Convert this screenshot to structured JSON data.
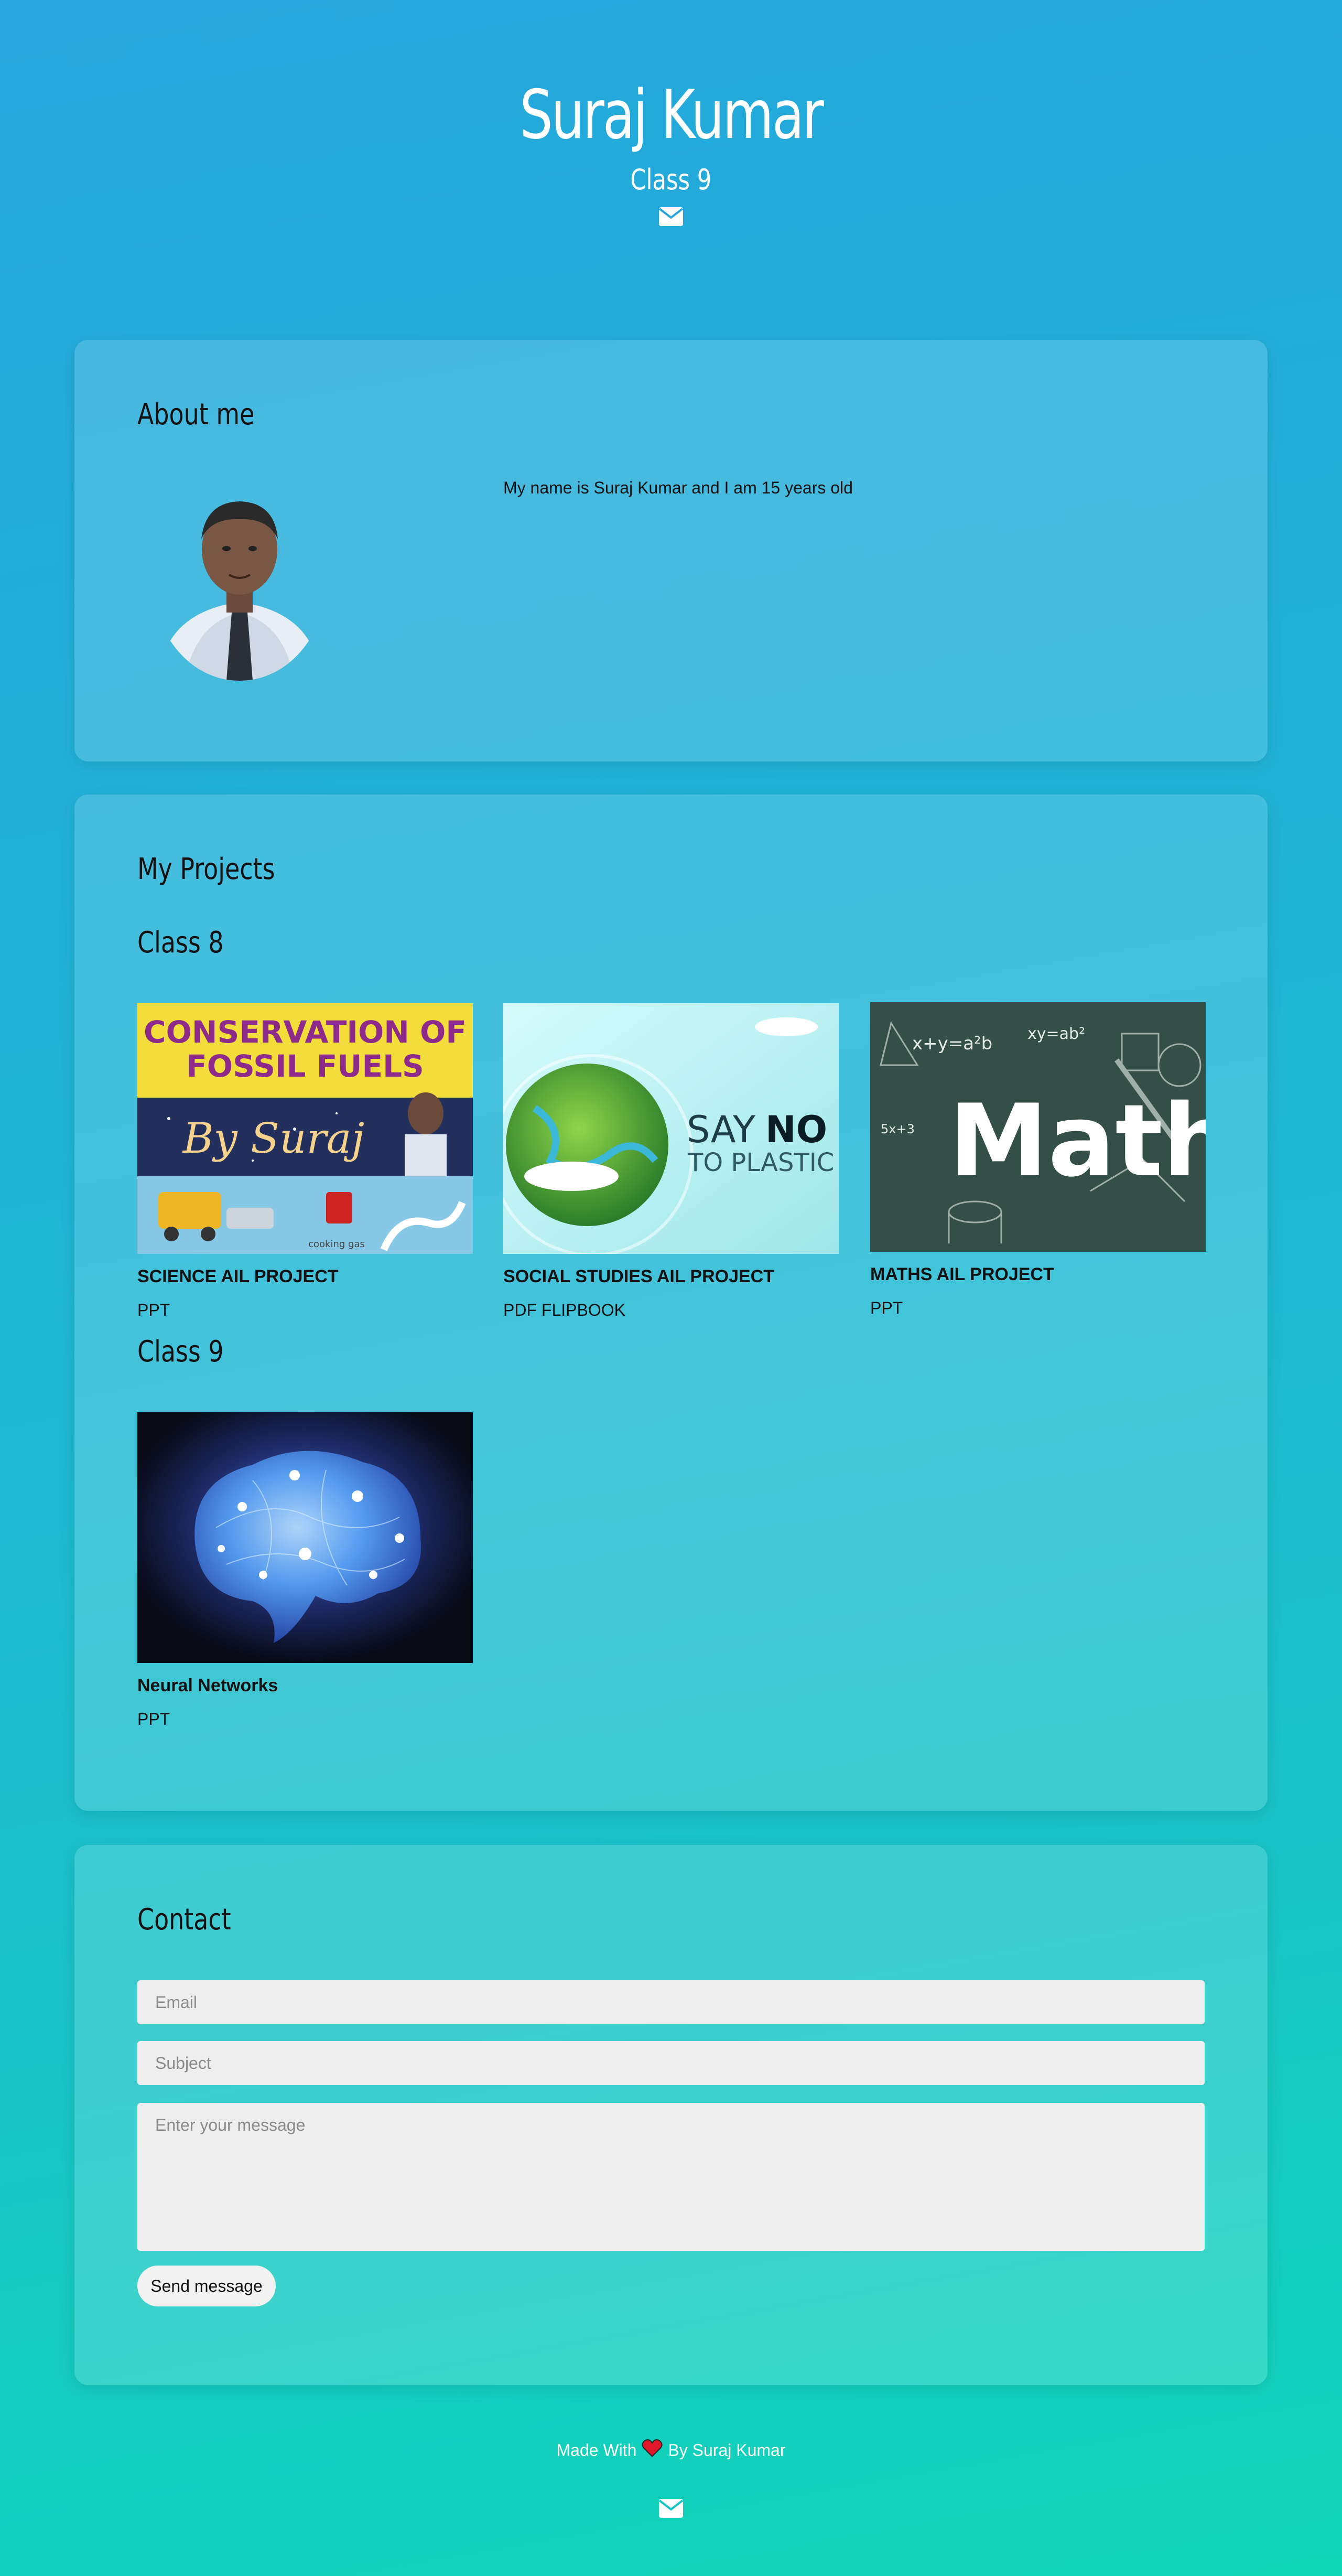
{
  "header": {
    "name": "Suraj Kumar",
    "subtitle": "Class 9",
    "icon": "envelope-icon"
  },
  "about": {
    "title": "About me",
    "text": "My name is Suraj Kumar and I am 15 years old"
  },
  "projects": {
    "title": "My Projects",
    "groups": [
      {
        "label": "Class 8",
        "items": [
          {
            "title": "SCIENCE AIL PROJECT",
            "type": "PPT",
            "thumb_text": [
              "CONSERVATION OF",
              "FOSSIL FUELS",
              "By Suraj",
              "cooking gas"
            ]
          },
          {
            "title": "SOCIAL STUDIES AIL PROJECT",
            "type": "PDF FLIPBOOK",
            "thumb_text": [
              "SAY",
              "NO",
              "TO PLASTIC"
            ]
          },
          {
            "title": "MATHS AIL PROJECT",
            "type": "PPT",
            "thumb_text": [
              "Math",
              "x+y=a²b",
              "xy=ab²",
              "5x+3"
            ]
          }
        ]
      },
      {
        "label": "Class 9",
        "items": [
          {
            "title": "Neural Networks",
            "type": "PPT"
          }
        ]
      }
    ]
  },
  "contact": {
    "title": "Contact",
    "email_placeholder": "Email",
    "subject_placeholder": "Subject",
    "message_placeholder": "Enter your message",
    "send_label": "Send message"
  },
  "footer": {
    "made_with": "Made With",
    "by": "By Suraj Kumar",
    "icon": "envelope-icon"
  },
  "colors": {
    "bg_top": "#25a6dc",
    "bg_bottom": "#10d6b8",
    "card": "rgba(255,255,255,0.16)",
    "input_bg": "#eeeeee",
    "heart": "#e0162b"
  }
}
